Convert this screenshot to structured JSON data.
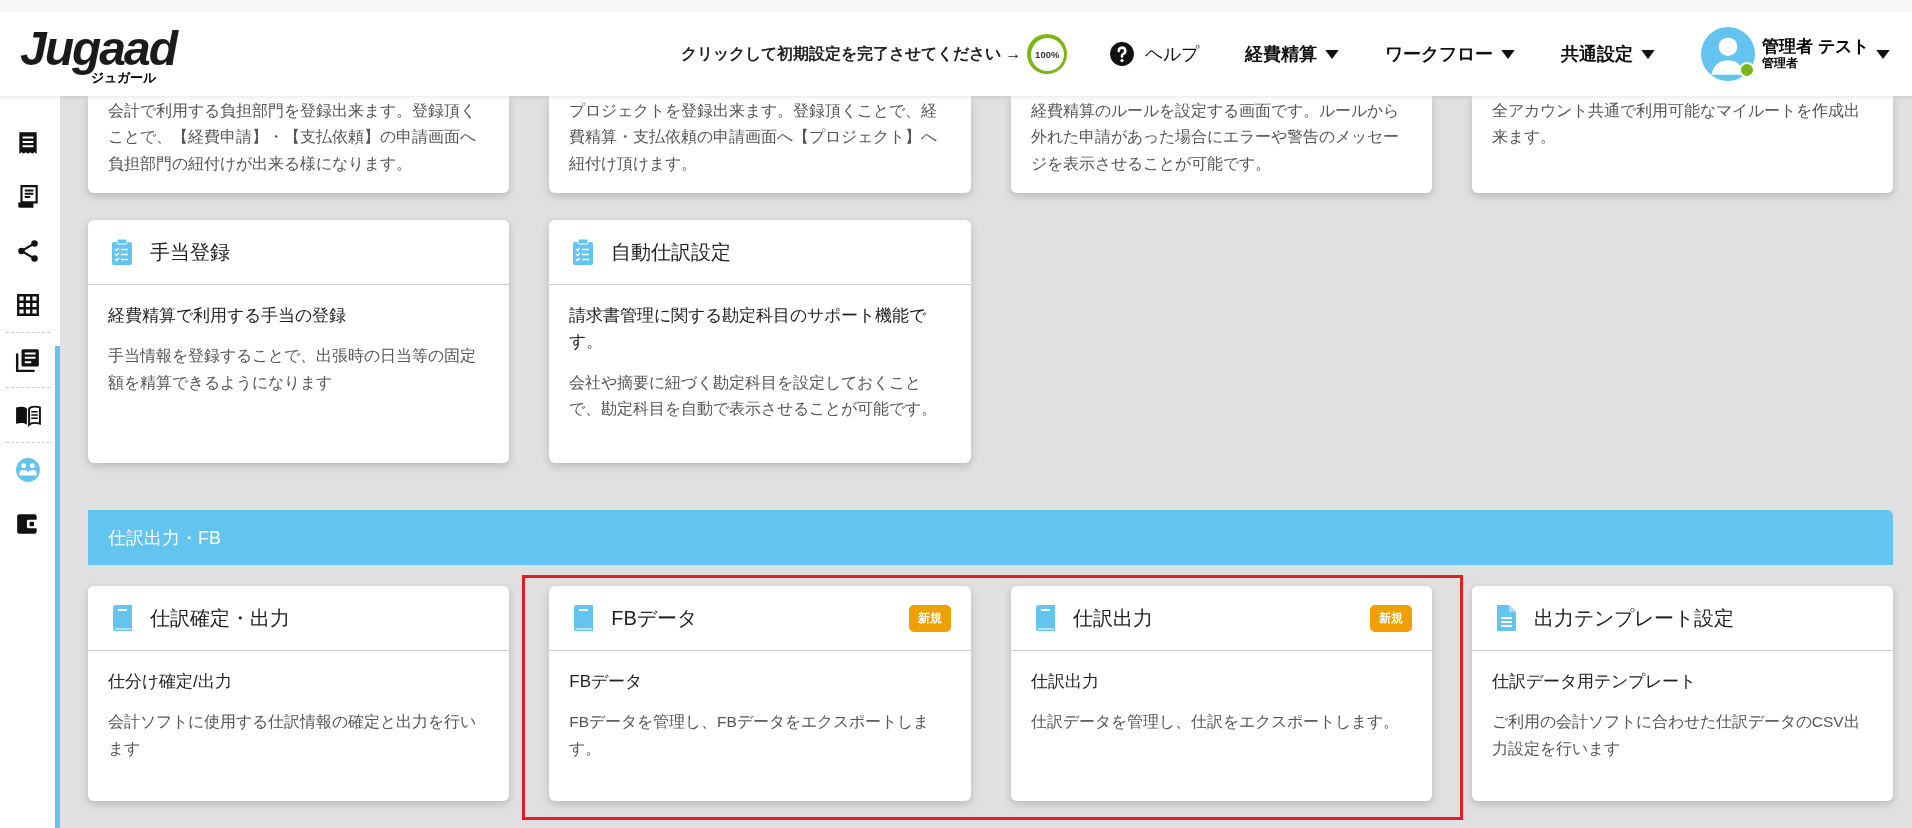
{
  "header": {
    "logo": {
      "name": "Jugaad",
      "subtitle": "ジュガール"
    },
    "setup": {
      "text": "クリックして初期設定を完了させてください →",
      "progress": "100%",
      "level": 1
    },
    "help": "ヘルプ",
    "menus": [
      "経費精算",
      "ワークフロー",
      "共通設定"
    ],
    "user": {
      "name": "管理者 テスト",
      "role": "管理者",
      "online": true
    }
  },
  "sidebar": {
    "items": [
      {
        "selected": false
      },
      {
        "selected": false
      },
      {
        "selected": false
      },
      {
        "selected": false
      },
      {
        "selected": false
      },
      {
        "selected": false
      },
      {
        "selected": true
      },
      {
        "selected": false
      }
    ]
  },
  "sections": [
    {
      "cards": [
        {
          "description": "会計で利用する負担部門を登録出来ます。登録頂くことで、【経費申請】・【支払依頼】の申請画面へ負担部門の紐付けが出来る様になります。"
        },
        {
          "description": "プロジェクトを登録出来ます。登録頂くことで、経費精算・支払依頼の申請画面へ【プロジェクト】へ紐付け頂けます。"
        },
        {
          "description": "経費精算のルールを設定する画面です。ルールから外れた申請があった場合にエラーや警告のメッセージを表示させることが可能です。"
        },
        {
          "description": "全アカウント共通で利用可能なマイルートを作成出来ます。"
        },
        {
          "title": "手当登録",
          "subtitle": "経費精算で利用する手当の登録",
          "description": "手当情報を登録することで、出張時の日当等の固定額を精算できるようになります"
        },
        {
          "title": "自動仕訳設定",
          "subtitle": "請求書管理に関する勘定科目のサポート機能です。",
          "description": "会社や摘要に紐づく勘定科目を設定しておくことで、勘定科目を自動で表示させることが可能です。"
        }
      ]
    },
    {
      "title": "仕訳出力・FB",
      "annotation_frame": true,
      "cards": [
        {
          "title": "仕訳確定・出力",
          "subtitle": "仕分け確定/出力",
          "description": "会計ソフトに使用する仕訳情報の確定と出力を行います"
        },
        {
          "title": "FBデータ",
          "badge": "新規",
          "subtitle": "FBデータ",
          "description": "FBデータを管理し、FBデータをエクスポートします。"
        },
        {
          "title": "仕訳出力",
          "badge": "新規",
          "subtitle": "仕訳出力",
          "description": "仕訳データを管理し、仕訳をエクスポートします。"
        },
        {
          "title": "出力テンプレート設定",
          "subtitle": "仕訳データ用テンプレート",
          "description": "ご利用の会計ソフトに合わせた仕訳データのCSV出力設定を行います"
        }
      ]
    }
  ]
}
